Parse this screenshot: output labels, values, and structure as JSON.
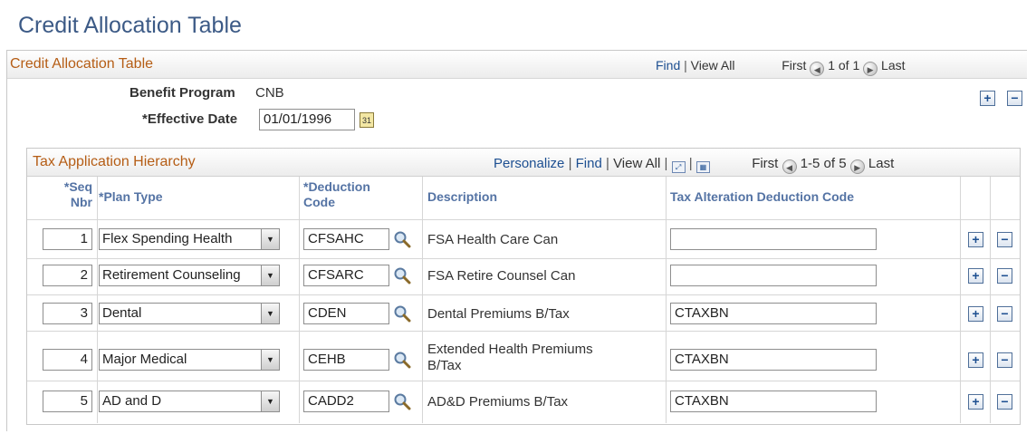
{
  "page": {
    "title": "Credit Allocation Table"
  },
  "frame": {
    "title": "Credit Allocation Table",
    "nav": {
      "find": "Find",
      "sep": "|",
      "view_all": "View All",
      "first": "First",
      "range": "1 of 1",
      "last": "Last"
    }
  },
  "header": {
    "benefit_program_label": "Benefit Program",
    "benefit_program_value": "CNB",
    "effective_date_label": "*Effective Date",
    "effective_date_value": "01/01/1996"
  },
  "grid": {
    "title": "Tax Application Hierarchy",
    "nav": {
      "personalize": "Personalize",
      "sep": "|",
      "find": "Find",
      "view_all": "View All",
      "first": "First",
      "range": "1-5 of 5",
      "last": "Last"
    },
    "columns": {
      "seq_line1": "*Seq",
      "seq_line2": "Nbr",
      "plan_type": "*Plan Type",
      "ded_line1": "*Deduction",
      "ded_line2": "Code",
      "description": "Description",
      "tax_alt": "Tax Alteration Deduction Code"
    },
    "rows": [
      {
        "seq": "1",
        "plan_type": "Flex Spending Health",
        "ded_code": "CFSAHC",
        "desc1": "FSA Health Care Can",
        "desc2": "",
        "tax_alt": ""
      },
      {
        "seq": "2",
        "plan_type": "Retirement Counseling",
        "ded_code": "CFSARC",
        "desc1": "FSA Retire Counsel Can",
        "desc2": "",
        "tax_alt": ""
      },
      {
        "seq": "3",
        "plan_type": "Dental",
        "ded_code": "CDEN",
        "desc1": "Dental Premiums B/Tax",
        "desc2": "",
        "tax_alt": "CTAXBN"
      },
      {
        "seq": "4",
        "plan_type": "Major Medical",
        "ded_code": "CEHB",
        "desc1": "Extended Health Premiums",
        "desc2": "B/Tax",
        "tax_alt": "CTAXBN"
      },
      {
        "seq": "5",
        "plan_type": "AD and D",
        "ded_code": "CADD2",
        "desc1": "AD&D Premiums B/Tax",
        "desc2": "",
        "tax_alt": "CTAXBN"
      }
    ]
  },
  "icons": {
    "plus": "+",
    "minus": "−",
    "prev": "◀",
    "next": "▶",
    "dropdown": "▼",
    "calendar": "31"
  },
  "colors": {
    "title": "#3c5a86",
    "section": "#b55d15",
    "link": "#1d4f91",
    "column_header": "#5473a4"
  }
}
